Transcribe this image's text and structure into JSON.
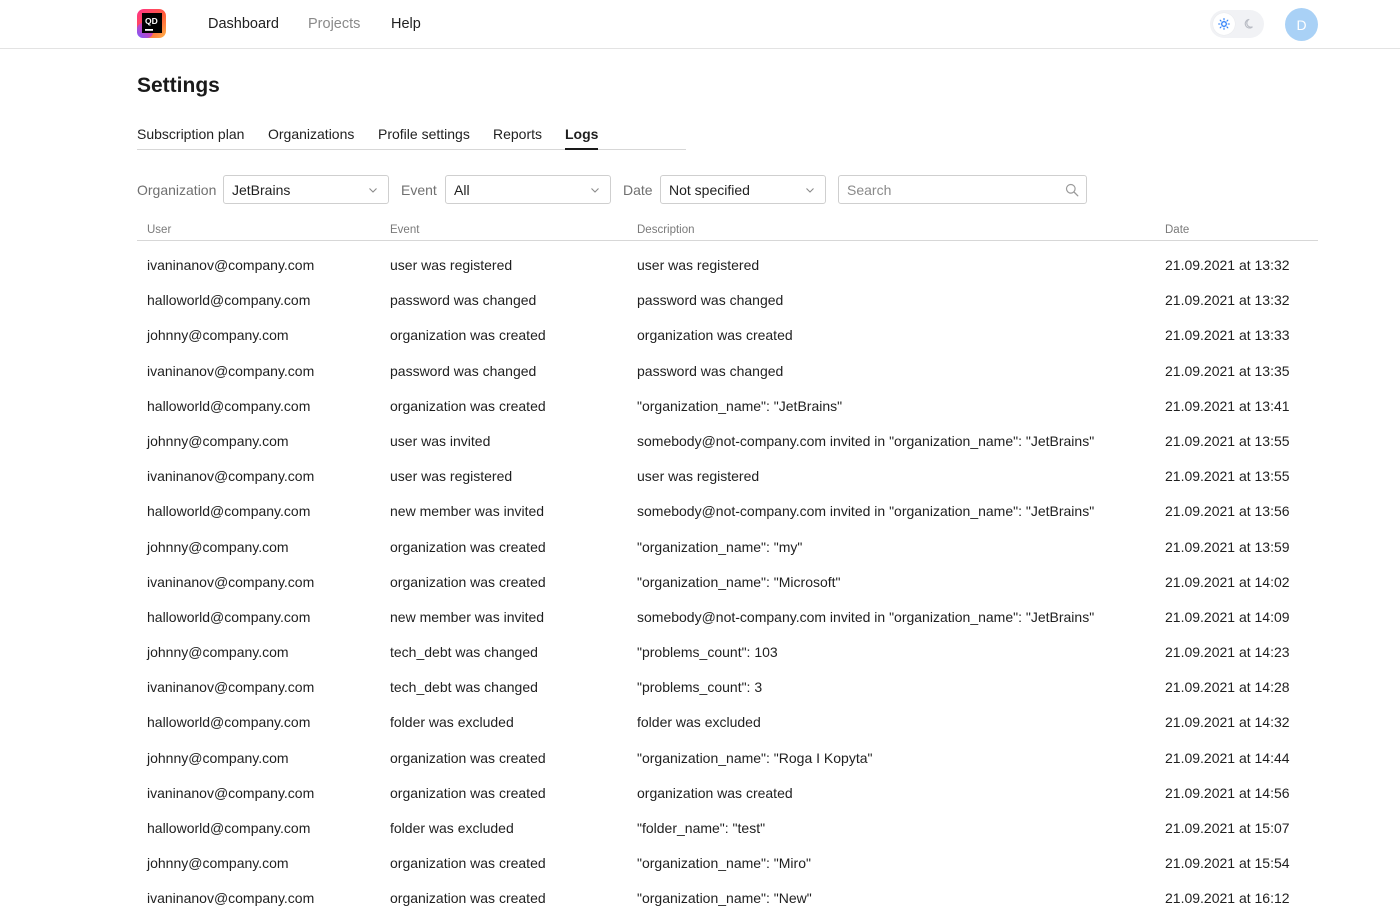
{
  "nav": {
    "logo_text": "QD",
    "items": [
      "Dashboard",
      "Projects",
      "Help"
    ],
    "avatar_initial": "D"
  },
  "page_title": "Settings",
  "tabs": [
    "Subscription plan",
    "Organizations",
    "Profile settings",
    "Reports",
    "Logs"
  ],
  "active_tab": "Logs",
  "filters": {
    "organization_label": "Organization",
    "organization_value": "JetBrains",
    "event_label": "Event",
    "event_value": "All",
    "date_label": "Date",
    "date_value": "Not specified",
    "search_placeholder": "Search"
  },
  "table": {
    "headers": [
      "User",
      "Event",
      "Description",
      "Date"
    ],
    "rows": [
      [
        "ivaninanov@company.com",
        "user was registered",
        "user was registered",
        "21.09.2021 at 13:32"
      ],
      [
        "halloworld@company.com",
        "password was changed",
        "password was changed",
        "21.09.2021 at 13:32"
      ],
      [
        "johnny@company.com",
        "organization was created",
        "organization was created",
        "21.09.2021 at 13:33"
      ],
      [
        "ivaninanov@company.com",
        "password was changed",
        "password was changed",
        "21.09.2021 at 13:35"
      ],
      [
        "halloworld@company.com",
        "organization was created",
        " \"organization_name\": \"JetBrains\"",
        "21.09.2021 at 13:41"
      ],
      [
        "johnny@company.com",
        "user was invited",
        "somebody@not-company.com invited in \"organization_name\": \"JetBrains\"",
        "21.09.2021 at 13:55"
      ],
      [
        "ivaninanov@company.com",
        "user was registered",
        "user was registered",
        "21.09.2021 at 13:55"
      ],
      [
        "halloworld@company.com",
        "new member was invited",
        "somebody@not-company.com invited in \"organization_name\": \"JetBrains\"",
        "21.09.2021 at 13:56"
      ],
      [
        "johnny@company.com",
        "organization was created",
        " \"organization_name\": \"my\"",
        "21.09.2021 at 13:59"
      ],
      [
        "ivaninanov@company.com",
        "organization was created",
        " \"organization_name\": \"Microsoft\"",
        "21.09.2021 at 14:02"
      ],
      [
        "halloworld@company.com",
        "new member was invited",
        "somebody@not-company.com invited in \"organization_name\": \"JetBrains\"",
        "21.09.2021 at 14:09"
      ],
      [
        "johnny@company.com",
        "tech_debt was changed",
        "\"problems_count\": 103",
        "21.09.2021 at 14:23"
      ],
      [
        "ivaninanov@company.com",
        "tech_debt was changed",
        "\"problems_count\": 3",
        "21.09.2021 at 14:28"
      ],
      [
        "halloworld@company.com",
        "folder was excluded",
        "folder was excluded",
        "21.09.2021 at 14:32"
      ],
      [
        "johnny@company.com",
        "organization was created",
        " \"organization_name\": \"Roga I Kopyta\"",
        "21.09.2021 at 14:44"
      ],
      [
        "ivaninanov@company.com",
        "organization was created",
        "organization was created",
        "21.09.2021 at 14:56"
      ],
      [
        "halloworld@company.com",
        "folder was excluded",
        "\"folder_name\": \"test\"",
        "21.09.2021 at 15:07"
      ],
      [
        "johnny@company.com",
        "organization was created",
        " \"organization_name\": \"Miro\"",
        "21.09.2021 at 15:54"
      ],
      [
        "ivaninanov@company.com",
        "organization was created",
        " \"organization_name\": \"New\"",
        "21.09.2021 at 16:12"
      ]
    ]
  },
  "colors": {
    "accent": "#1a1a1a",
    "avatar_bg": "#a9d1f6",
    "muted_text": "#7a7a7a",
    "border": "#d7d7d7"
  },
  "icons": [
    "qodana-logo-icon",
    "sun-icon",
    "moon-icon",
    "chevron-down-icon",
    "search-icon"
  ]
}
